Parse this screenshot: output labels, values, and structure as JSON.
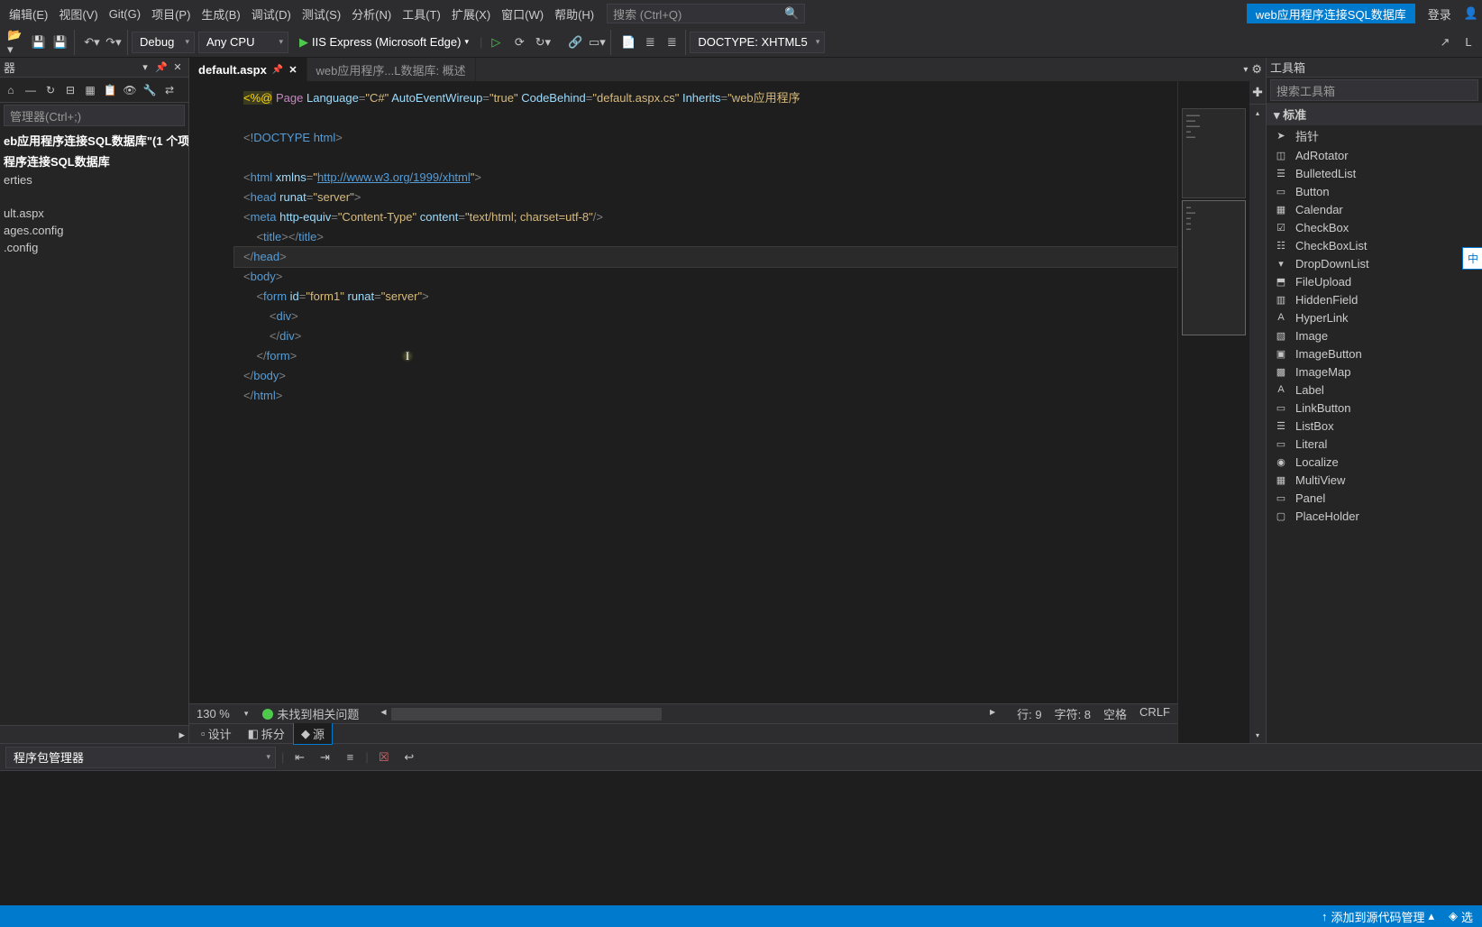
{
  "menubar": {
    "items": [
      {
        "label": "编辑(E)"
      },
      {
        "label": "视图(V)"
      },
      {
        "label": "Git(G)"
      },
      {
        "label": "项目(P)"
      },
      {
        "label": "生成(B)"
      },
      {
        "label": "调试(D)"
      },
      {
        "label": "测试(S)"
      },
      {
        "label": "分析(N)"
      },
      {
        "label": "工具(T)"
      },
      {
        "label": "扩展(X)"
      },
      {
        "label": "窗口(W)"
      },
      {
        "label": "帮助(H)"
      }
    ],
    "search_placeholder": "搜索 (Ctrl+Q)",
    "solution_name": "web应用程序连接SQL数据库",
    "login": "登录"
  },
  "toolbar": {
    "config": "Debug",
    "platform": "Any CPU",
    "run_label": "IIS Express (Microsoft Edge)",
    "doctype": "DOCTYPE: XHTML5"
  },
  "left_panel": {
    "title": "器",
    "search_placeholder": "管理器(Ctrl+;)",
    "tree": [
      {
        "label": "eb应用程序连接SQL数据库\"(1 个项",
        "bold": true
      },
      {
        "label": "程序连接SQL数据库",
        "bold": true
      },
      {
        "label": "erties"
      },
      {
        "label": "ult.aspx"
      },
      {
        "label": "ages.config"
      },
      {
        "label": ".config"
      }
    ]
  },
  "tabs": [
    {
      "label": "default.aspx",
      "active": true,
      "pinned": true
    },
    {
      "label": "web应用程序...L数据库: 概述",
      "active": false
    }
  ],
  "right_panel": {
    "title": "工具箱",
    "search_placeholder": "搜索工具箱",
    "section": "标准",
    "items": [
      {
        "icon": "➤",
        "name": "指针"
      },
      {
        "icon": "◫",
        "name": "AdRotator"
      },
      {
        "icon": "☰",
        "name": "BulletedList"
      },
      {
        "icon": "▭",
        "name": "Button"
      },
      {
        "icon": "▦",
        "name": "Calendar"
      },
      {
        "icon": "☑",
        "name": "CheckBox"
      },
      {
        "icon": "☷",
        "name": "CheckBoxList"
      },
      {
        "icon": "▾",
        "name": "DropDownList"
      },
      {
        "icon": "⬒",
        "name": "FileUpload"
      },
      {
        "icon": "▥",
        "name": "HiddenField"
      },
      {
        "icon": "A",
        "name": "HyperLink"
      },
      {
        "icon": "▧",
        "name": "Image"
      },
      {
        "icon": "▣",
        "name": "ImageButton"
      },
      {
        "icon": "▩",
        "name": "ImageMap"
      },
      {
        "icon": "A",
        "name": "Label"
      },
      {
        "icon": "▭",
        "name": "LinkButton"
      },
      {
        "icon": "☰",
        "name": "ListBox"
      },
      {
        "icon": "▭",
        "name": "Literal"
      },
      {
        "icon": "◉",
        "name": "Localize"
      },
      {
        "icon": "▦",
        "name": "MultiView"
      },
      {
        "icon": "▭",
        "name": "Panel"
      },
      {
        "icon": "▢",
        "name": "PlaceHolder"
      }
    ],
    "side_badge": "中"
  },
  "editor_status": {
    "zoom": "130 %",
    "issues": "未找到相关问题",
    "line": "行: 9",
    "col": "字符: 8",
    "ins": "空格",
    "eol": "CRLF"
  },
  "view_tabs": [
    {
      "icon": "▫",
      "label": "设计"
    },
    {
      "icon": "◧",
      "label": "拆分"
    },
    {
      "icon": "◆",
      "label": "源",
      "active": true
    }
  ],
  "bottom_panel": {
    "dropdown": "程序包管理器"
  },
  "statusbar": {
    "source_control": "添加到源代码管理",
    "select": "选"
  },
  "code": {
    "page_directive": {
      "at": "%@",
      "page": "Page",
      "lang_attr": "Language",
      "lang_val": "\"C#\"",
      "wire_attr": "AutoEventWireup",
      "wire_val": "\"true\"",
      "cb_attr": "CodeBehind",
      "cb_val": "\"default.aspx.cs\"",
      "inh_attr": "Inherits",
      "inh_val": "\"web应用程序"
    },
    "doctype": {
      "decl": "!DOCTYPE",
      "val": "html"
    },
    "html_open": {
      "tag": "html",
      "attr": "xmlns",
      "val_pre": "\"",
      "link": "http://www.w3.org/1999/xhtml",
      "val_post": "\""
    },
    "head_open": {
      "tag": "head",
      "attr": "runat",
      "val": "\"server\""
    },
    "meta": {
      "tag": "meta",
      "attr1": "http-equiv",
      "val1": "\"Content-Type\"",
      "attr2": "content",
      "val2": "\"text/html; charset=utf-8\""
    },
    "title": {
      "tag": "title"
    },
    "head_close": "head",
    "body_open": "body",
    "form": {
      "tag": "form",
      "attr1": "id",
      "val1": "\"form1\"",
      "attr2": "runat",
      "val2": "\"server\""
    },
    "div": "div",
    "form_close": "form",
    "body_close": "body",
    "html_close": "html"
  }
}
